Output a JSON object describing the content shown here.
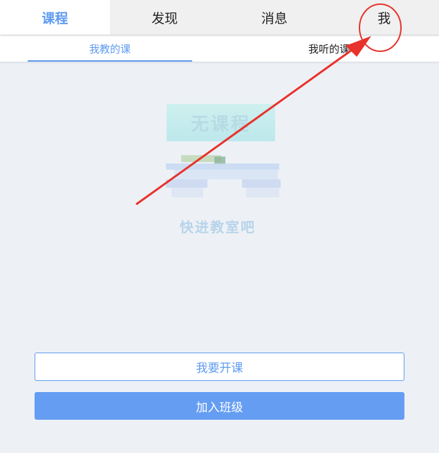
{
  "tabs": [
    {
      "label": "课程",
      "active": true
    },
    {
      "label": "发现",
      "active": false
    },
    {
      "label": "消息",
      "active": false
    },
    {
      "label": "我",
      "active": false
    }
  ],
  "subtabs": {
    "teaching": "我教的课",
    "attending": "我听的课"
  },
  "empty_state": {
    "title": "无课程",
    "subtitle": "快进教室吧"
  },
  "buttons": {
    "start_course": "我要开课",
    "join_class": "加入班级"
  },
  "colors": {
    "accent": "#5e9bf0",
    "annotation": "#e8322b"
  }
}
